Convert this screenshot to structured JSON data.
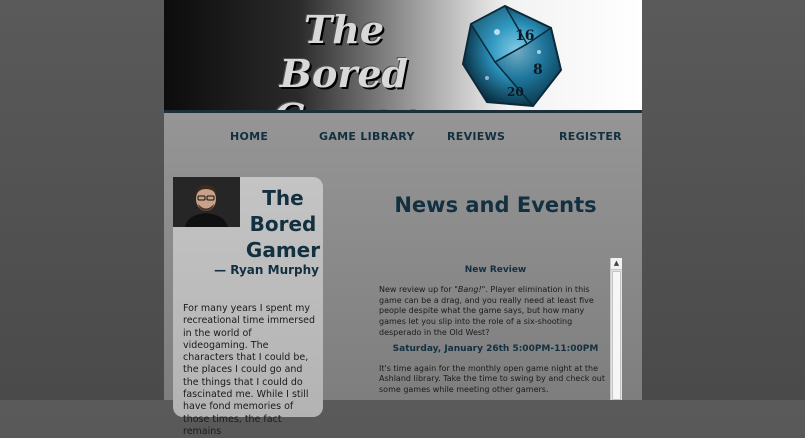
{
  "brand": {
    "line1": "The Bored",
    "line2": "Gamer"
  },
  "nav": {
    "items": [
      "HOME",
      "GAME LIBRARY",
      "REVIEWS",
      "REGISTER"
    ]
  },
  "profile": {
    "name_lines": [
      "The",
      "Bored",
      "Gamer"
    ],
    "byline": "— Ryan Murphy",
    "bio": "For many years I spent my recreational time immersed in the world of videogaming. The characters that I could be, the places I could go and the things that I could do fascinated me. While I still have fond memories of those times, the fact remains"
  },
  "main": {
    "headline": "News and Events",
    "items": [
      {
        "title": "New Review",
        "body_prefix": "New review up for ",
        "body_emphasis": "\"Bang!\"",
        "body_suffix": ". Player elimination in this game can be a drag, and you really need at least five people despite what the game says, but how many games let you slip into the role of a six-shooting desperado in the Old West?"
      },
      {
        "title": "Saturday, January 26th 5:00PM-11:00PM",
        "body": "It's time again for the monthly open game night at the Ashland library. Take the time to swing by and check out some games while meeting other gamers."
      }
    ]
  },
  "colors": {
    "accent": "#12303f",
    "dice": "#2a8fb8"
  },
  "icons": {
    "scroll_up": "arrow-up-icon"
  }
}
